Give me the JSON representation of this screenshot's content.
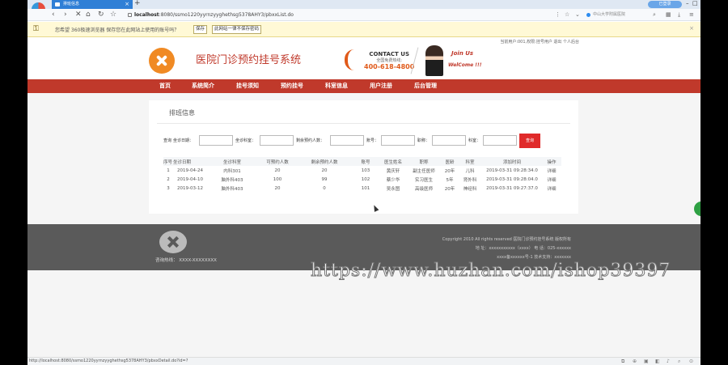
{
  "browser": {
    "tab_title": "排班信息",
    "tab_close": "×",
    "new_tab": "+",
    "user_pill": "已登录",
    "url_host": "localhost",
    "url_rest": ":8080/ssmo1220yyrnzyyghethsg5378AHY3/pbxxList.do",
    "search_placeholder": "中山大学附属医院",
    "nav": {
      "back": "‹",
      "forward": "›",
      "stop": "✕",
      "refresh": "↻",
      "star": "☆"
    },
    "right_icons": [
      "⋮",
      "☆",
      "⌕",
      "▦",
      "⤓",
      "≡"
    ]
  },
  "password_bar": {
    "text": "您希望 360极速浏览器 保存您在此网站上使用的账号吗？",
    "save": "保存",
    "never": "此网站一律不保存密码",
    "close": "×"
  },
  "header": {
    "top_links": "当前用户:001,权限:挂号用户 退出 个人后台",
    "site_title": "医院门诊预约挂号系统",
    "contact_title": "CONTACT US",
    "contact_sub": "全国免费热线:",
    "phone": "400-618-4800",
    "join": "Join Us",
    "welcome": "WelCome !!!"
  },
  "menu": [
    "首页",
    "系统简介",
    "挂号须知",
    "预约挂号",
    "科室信息",
    "用户注册",
    "后台管理"
  ],
  "panel": {
    "title": "排班信息",
    "search": {
      "prefix": "查询",
      "labels": [
        "坐诊日期：",
        "坐诊科室：",
        "剩余预约人数：",
        "账号：",
        "职称：",
        "科室："
      ],
      "button": "查询"
    },
    "table": {
      "headers": [
        "序号",
        "坐诊日期",
        "坐诊科室",
        "可预约人数",
        "剩余预约人数",
        "账号",
        "医生姓名",
        "职称",
        "医龄",
        "科室",
        "添加时间",
        "操作"
      ],
      "rows": [
        [
          "1",
          "2019-04-24",
          "内科301",
          "20",
          "20",
          "103",
          "黄庆轩",
          "副主任医师",
          "20年",
          "儿科",
          "2019-03-31 09:28:34.0",
          "详细"
        ],
        [
          "2",
          "2019-04-10",
          "脑外科403",
          "100",
          "99",
          "102",
          "蔡少华",
          "实习医生",
          "5年",
          "肾外科",
          "2019-03-31 09:28:04.0",
          "详细"
        ],
        [
          "3",
          "2019-03-12",
          "脑外科403",
          "20",
          "0",
          "101",
          "吴永图",
          "高级医师",
          "20年",
          "神经科",
          "2019-03-31 09:27:37.0",
          "详细"
        ]
      ]
    }
  },
  "footer": {
    "hotline": "咨询热线：  XXXX-XXXXXXXX",
    "copyright": "Copyright 2010 All rights reserved 医院门诊预约挂号系统 版权所有",
    "address": "地 址：xxxxxxxxxxx（xxxx）  电 话：025-xxxxxx",
    "icp": "xxxx备xxxxxx号-1  技术支持：xxxxxxx"
  },
  "watermark": "https://www.huzhan.com/ishop39397",
  "status_url": "http://localhost:8080/ssmo1220yyrnzyyghethsg5378AHY3/pbxxDetail.do?id=?",
  "status_icons": [
    "⧉",
    "⊕",
    "▣",
    "◧",
    "♪",
    "⌕",
    "⊙"
  ]
}
